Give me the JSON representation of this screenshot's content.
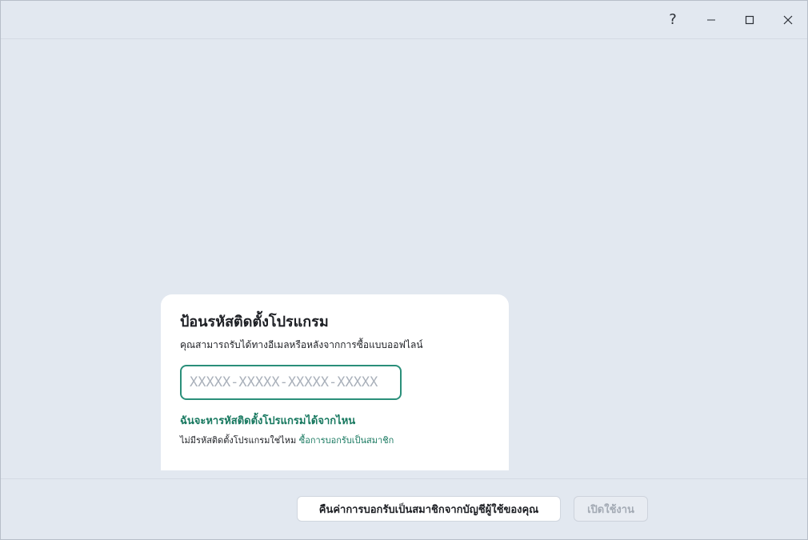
{
  "titlebar": {
    "help_label": "?",
    "icons": [
      "help-icon",
      "minimize-icon",
      "maximize-icon",
      "close-icon"
    ]
  },
  "card": {
    "title": "ป้อนรหัสติดตั้งโปรแกรม",
    "subtitle": "คุณสามารถรับได้ทางอีเมลหรือหลังจากการซื้อแบบออฟไลน์",
    "code_input": {
      "value": "",
      "placeholder": "XXXXX-XXXXX-XXXXX-XXXXX"
    },
    "where_link": "ฉันจะหารหัสติดตั้งโปรแกรมได้จากไหน",
    "no_code_text": "ไม่มีรหัสติดตั้งโปรแกรมใช่ไหม",
    "buy_link": "ซื้อการบอกรับเป็นสมาชิก"
  },
  "footer": {
    "restore_label": "คืนค่าการบอกรับเป็นสมาชิกจากบัญชีผู้ใช้ของคุณ",
    "activate_label": "เปิดใช้งาน"
  },
  "colors": {
    "background": "#e2e8f0",
    "accent": "#17785f",
    "input_border": "#2a8f7a"
  }
}
